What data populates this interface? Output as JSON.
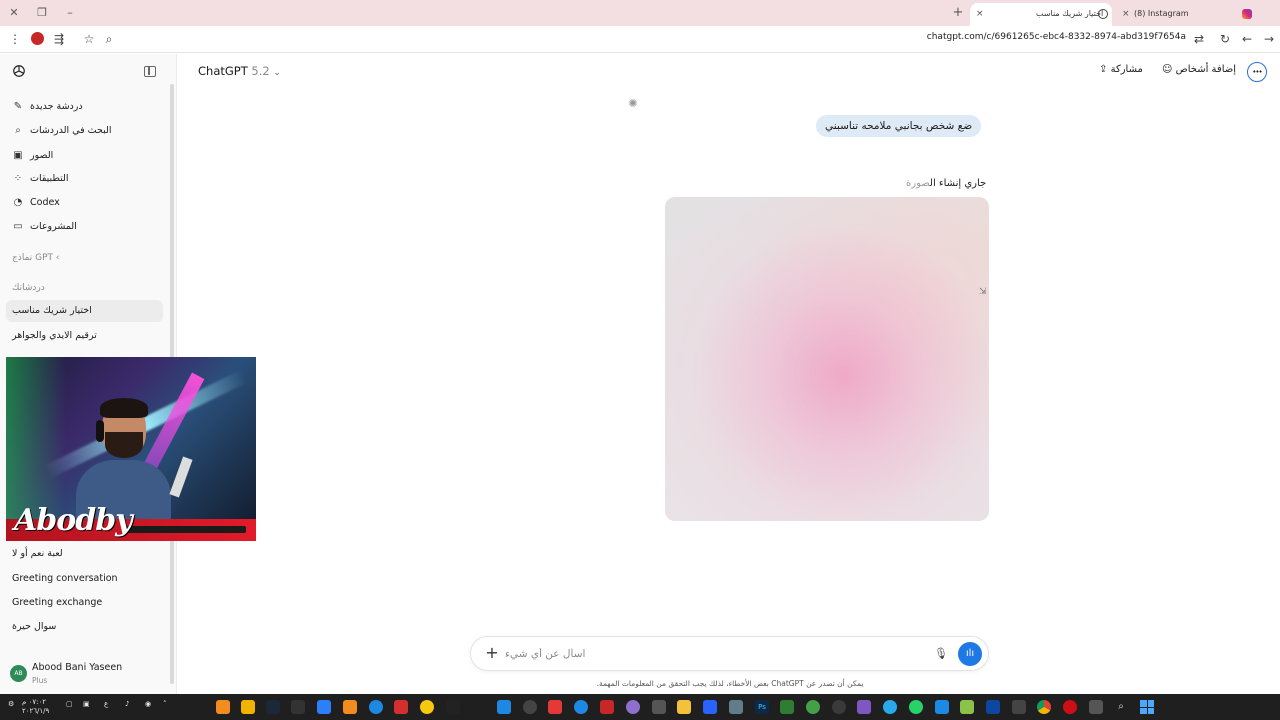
{
  "browser": {
    "tabs": [
      {
        "title": "اختيار شريك مناسب",
        "active": true
      },
      {
        "title": "(8) Instagram",
        "active": false
      }
    ],
    "url": "chatgpt.com/c/6961265c-ebc4-8332-8974-abd319f7654a",
    "new_tab": "+",
    "close": "×"
  },
  "sidebar": {
    "nav": [
      {
        "label": "دردشة جديدة",
        "icon": "new-chat-icon"
      },
      {
        "label": "البحث في الدردشات",
        "icon": "search-icon"
      },
      {
        "label": "الصور",
        "icon": "images-icon"
      },
      {
        "label": "التطبيقات",
        "icon": "apps-icon"
      },
      {
        "label": "Codex",
        "icon": "codex-icon"
      },
      {
        "label": "المشروعات",
        "icon": "folder-icon"
      }
    ],
    "gpts_label": "نماذج GPT",
    "chats_label": "دردشاتك",
    "chats": [
      {
        "title": "اختيار شريك مناسب",
        "active": true
      },
      {
        "title": "ترقيم الايدي والجواهر",
        "active": false
      },
      {
        "title": "لعبة نعم أو لا",
        "active": false
      },
      {
        "title": "Greeting conversation",
        "active": false
      },
      {
        "title": "Greeting exchange",
        "active": false
      },
      {
        "title": "سوال حيرة",
        "active": false
      }
    ],
    "user": {
      "name": "Abood Bani Yaseen",
      "plan": "Plus",
      "initials": "AB"
    }
  },
  "webcam": {
    "overlay_name": "Abodby"
  },
  "header": {
    "model": "ChatGPT",
    "version": "5.2",
    "share": "مشاركة",
    "add_people": "إضافة أشخاص",
    "more": "•••"
  },
  "conversation": {
    "user_message": "ضع شخص بجانبي ملامحه تناسبني",
    "status_main": "جاري إنشاء ال",
    "status_fade": "صورة"
  },
  "composer": {
    "placeholder": "اسأل عن أي شيء",
    "plus": "+",
    "disclaimer": "يمكن أن تصدر عن ChatGPT بعض الأخطاء، لذلك يجب التحقق من المعلومات المهمة."
  },
  "taskbar": {
    "time": "٠٧:٠٢ م",
    "date": "٢٠٢٦/١/٩",
    "lang": "ع"
  },
  "colors": {
    "accent": "#1e78e6",
    "bubble": "#dfeaf7",
    "tabbar": "#f3dfe1",
    "webcam_banner": "#e21b2a"
  }
}
